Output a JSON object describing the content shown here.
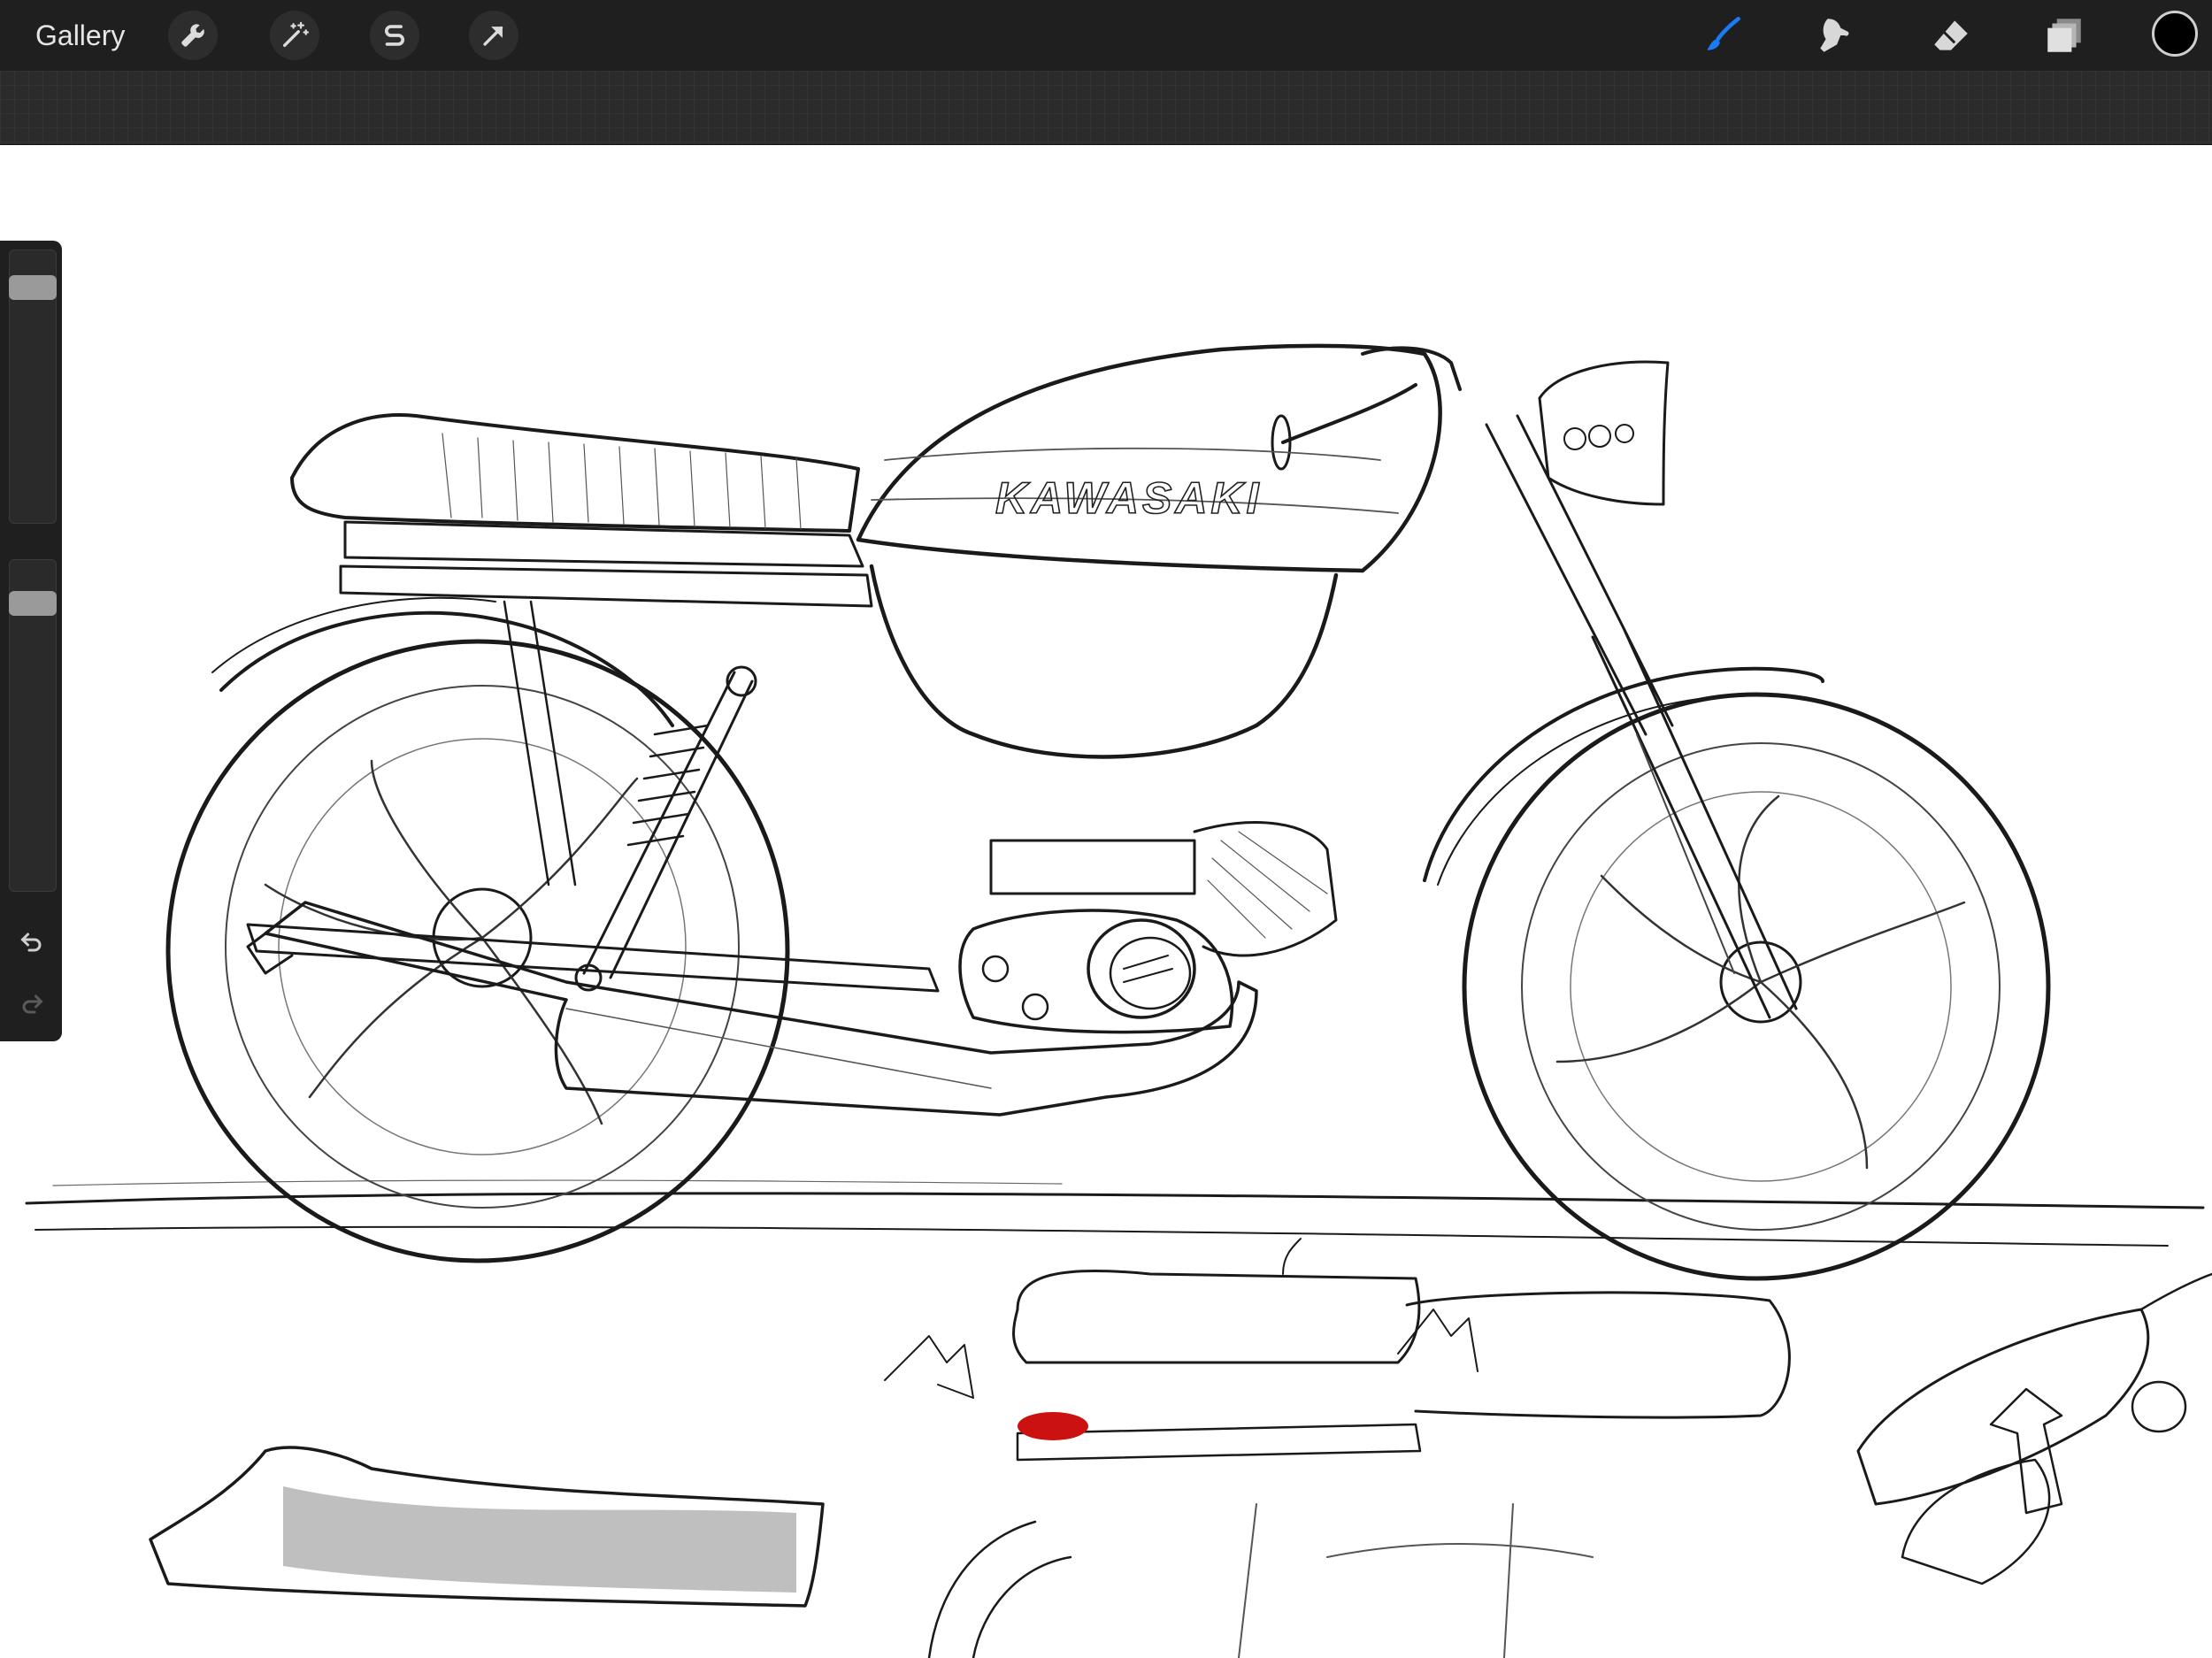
{
  "toolbar": {
    "gallery_label": "Gallery",
    "left_tools": [
      "wrench-icon",
      "magic-wand-icon",
      "selection-s-icon",
      "transform-arrow-icon"
    ],
    "right_tools": [
      "brush-icon",
      "smudge-icon",
      "eraser-icon",
      "layers-icon"
    ],
    "active_tool": "brush",
    "accent_color": "#1a7cf5",
    "current_color": "#000000"
  },
  "sidebar": {
    "brush_size": 0.9,
    "opacity": 0.9,
    "undo_icon": "undo-icon",
    "redo_icon": "redo-icon"
  },
  "canvas": {
    "tank_lettering": "KAWASAKI"
  }
}
